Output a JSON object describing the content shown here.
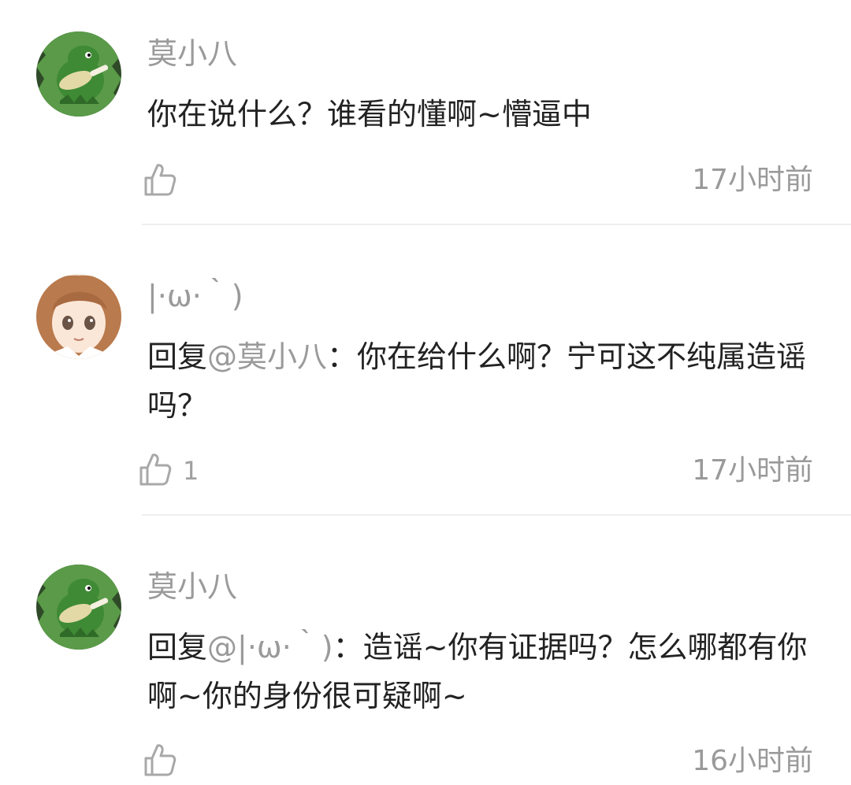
{
  "comments": [
    {
      "username": "莫小八",
      "avatar": "dinosaur-avatar",
      "reply_prefix": "",
      "mention": "",
      "text": "你在说什么？谁看的懂啊~懵逼中",
      "like_count": "",
      "time": "17小时前"
    },
    {
      "username": "|·ω·｀)",
      "avatar": "anime-girl-avatar",
      "reply_prefix": "回复",
      "mention": "@莫小八",
      "text": "：你在给什么啊？宁可这不纯属造谣吗？",
      "like_count": "1",
      "time": "17小时前"
    },
    {
      "username": "莫小八",
      "avatar": "dinosaur-avatar",
      "reply_prefix": "回复",
      "mention": "@|·ω·｀)",
      "text": "：造谣~你有证据吗？怎么哪都有你啊~你的身份很可疑啊~",
      "like_count": "",
      "time": "16小时前"
    }
  ],
  "icons": {
    "like": "thumbs-up-outline-icon"
  },
  "colors": {
    "username": "#9a9a9a",
    "text": "#222222",
    "divider": "#eeeeee",
    "avatar_green": "#4f8a3f"
  }
}
